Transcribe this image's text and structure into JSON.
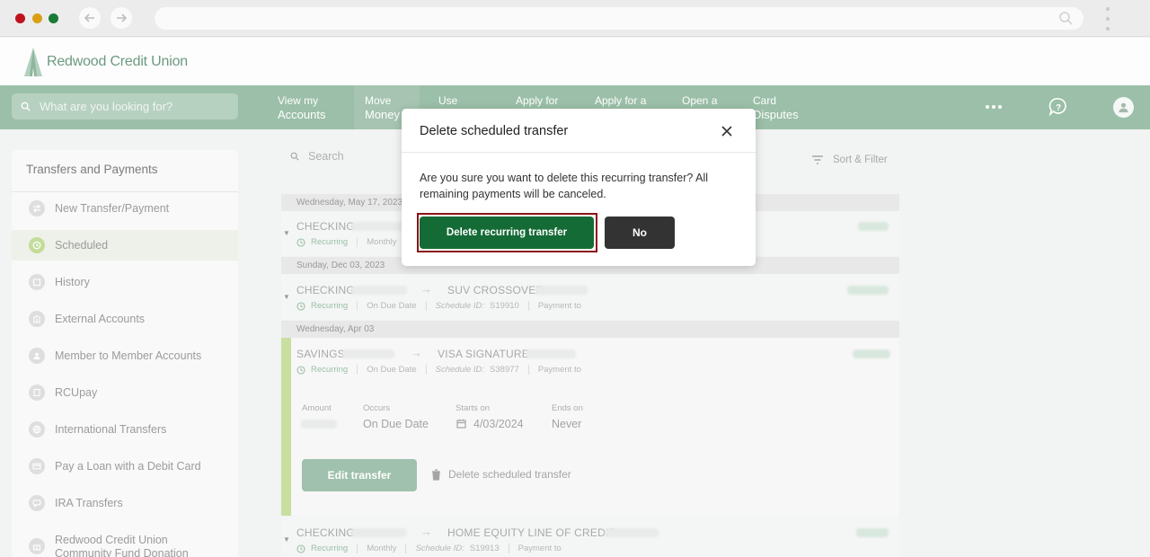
{
  "browser": {
    "url": ""
  },
  "header": {
    "logo_text": "Redwood Credit Union"
  },
  "navbar": {
    "search_placeholder": "What are you looking for?",
    "items": [
      {
        "line1": "View my",
        "line2": "Accounts"
      },
      {
        "line1": "Move",
        "line2": "Money"
      },
      {
        "line1": "Use",
        "line2": ""
      },
      {
        "line1": "Apply for",
        "line2": ""
      },
      {
        "line1": "Apply for a",
        "line2": ""
      },
      {
        "line1": "Open a",
        "line2": ""
      },
      {
        "line1": "Card",
        "line2": "Disputes"
      }
    ]
  },
  "sidebar": {
    "title": "Transfers and Payments",
    "items": [
      {
        "label": "New Transfer/Payment"
      },
      {
        "label": "Scheduled"
      },
      {
        "label": "History"
      },
      {
        "label": "External Accounts"
      },
      {
        "label": "Member to Member Accounts"
      },
      {
        "label": "RCUpay"
      },
      {
        "label": "International Transfers"
      },
      {
        "label": "Pay a Loan with a Debit Card"
      },
      {
        "label": "IRA Transfers"
      },
      {
        "label": "Redwood Credit Union Community Fund Donation"
      }
    ]
  },
  "main": {
    "search_placeholder": "Search",
    "sort_filter": "Sort & Filter",
    "groups": [
      {
        "date": "Wednesday, May 17, 2023",
        "from": "CHECKING",
        "to": "",
        "status": "Recurring",
        "frequency": "Monthly",
        "schedule_label": "",
        "schedule_id": "",
        "payment_to": ""
      },
      {
        "date": "Sunday, Dec 03, 2023",
        "from": "CHECKING",
        "to": "SUV CROSSOVER",
        "status": "Recurring",
        "frequency": "On Due Date",
        "schedule_label": "Schedule ID:",
        "schedule_id": "S19910",
        "payment_to": "Payment to"
      },
      {
        "date": "Wednesday, Apr 03",
        "from": "SAVINGS",
        "to": "VISA SIGNATURE",
        "status": "Recurring",
        "frequency": "On Due Date",
        "schedule_label": "Schedule ID:",
        "schedule_id": "S38977",
        "payment_to": "Payment to"
      },
      {
        "date": "",
        "from": "CHECKING",
        "to": "HOME EQUITY LINE OF CREDIT",
        "status": "Recurring",
        "frequency": "Monthly",
        "schedule_label": "Schedule ID:",
        "schedule_id": "S19913",
        "payment_to": "Payment to"
      }
    ],
    "expanded": {
      "amount_label": "Amount",
      "occurs_label": "Occurs",
      "occurs_value": "On Due Date",
      "starts_label": "Starts on",
      "starts_value": "4/03/2024",
      "ends_label": "Ends on",
      "ends_value": "Never",
      "edit_button": "Edit transfer",
      "delete_link": "Delete scheduled transfer"
    }
  },
  "modal": {
    "title": "Delete scheduled transfer",
    "body": "Are you sure you want to delete this recurring transfer? All remaining payments will be canceled.",
    "confirm_button": "Delete recurring transfer",
    "cancel_button": "No"
  },
  "colors": {
    "nav_green": "#9bbfa8",
    "primary_green": "#146b36",
    "highlight_red": "#8a1316",
    "dark_button": "#333333"
  }
}
